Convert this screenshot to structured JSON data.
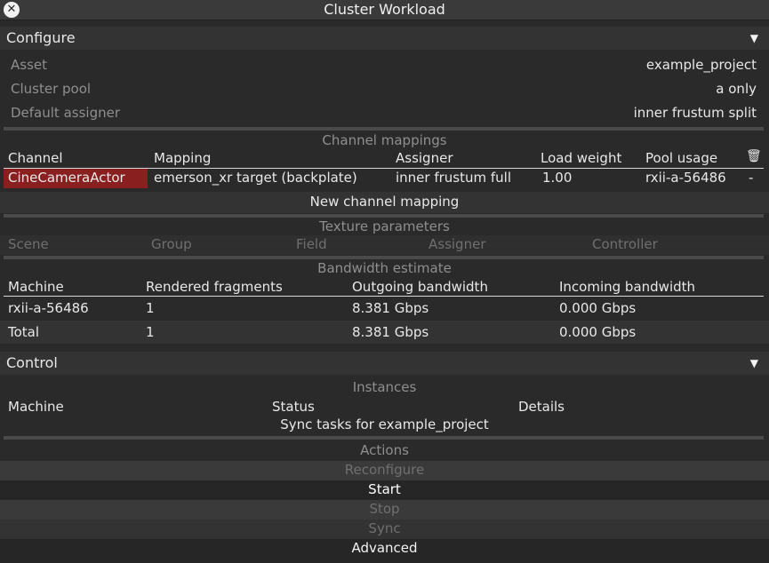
{
  "window": {
    "title": "Cluster Workload"
  },
  "configure": {
    "header": "Configure",
    "asset_label": "Asset",
    "asset_value": "example_project",
    "pool_label": "Cluster pool",
    "pool_value": "a only",
    "assigner_label": "Default assigner",
    "assigner_value": "inner frustum split"
  },
  "channel_mappings": {
    "title": "Channel mappings",
    "headers": [
      "Channel",
      "Mapping",
      "Assigner",
      "Load weight",
      "Pool usage"
    ],
    "row": {
      "channel": "CineCameraActor",
      "mapping": "emerson_xr target (backplate)",
      "assigner": "inner frustum full",
      "load_weight": "1.00",
      "pool_usage": "rxii-a-56486",
      "extra": "-"
    },
    "new_button": "New channel mapping"
  },
  "texture_parameters": {
    "title": "Texture parameters",
    "headers": [
      "Scene",
      "Group",
      "Field",
      "Assigner",
      "Controller"
    ]
  },
  "bandwidth": {
    "title": "Bandwidth estimate",
    "headers": [
      "Machine",
      "Rendered fragments",
      "Outgoing bandwidth",
      "Incoming bandwidth"
    ],
    "rows": [
      {
        "machine": "rxii-a-56486",
        "fragments": "1",
        "outgoing": "8.381 Gbps",
        "incoming": "0.000 Gbps"
      },
      {
        "machine": "Total",
        "fragments": "1",
        "outgoing": "8.381 Gbps",
        "incoming": "0.000 Gbps"
      }
    ]
  },
  "control": {
    "header": "Control",
    "instances_title": "Instances",
    "headers": [
      "Machine",
      "Status",
      "Details"
    ],
    "sync_text": "Sync tasks for example_project",
    "actions_title": "Actions",
    "buttons": {
      "reconfigure": "Reconfigure",
      "start": "Start",
      "stop": "Stop",
      "sync": "Sync",
      "advanced": "Advanced"
    }
  },
  "icons": [
    "close-icon",
    "collapse-triangle-icon",
    "trash-icon"
  ]
}
